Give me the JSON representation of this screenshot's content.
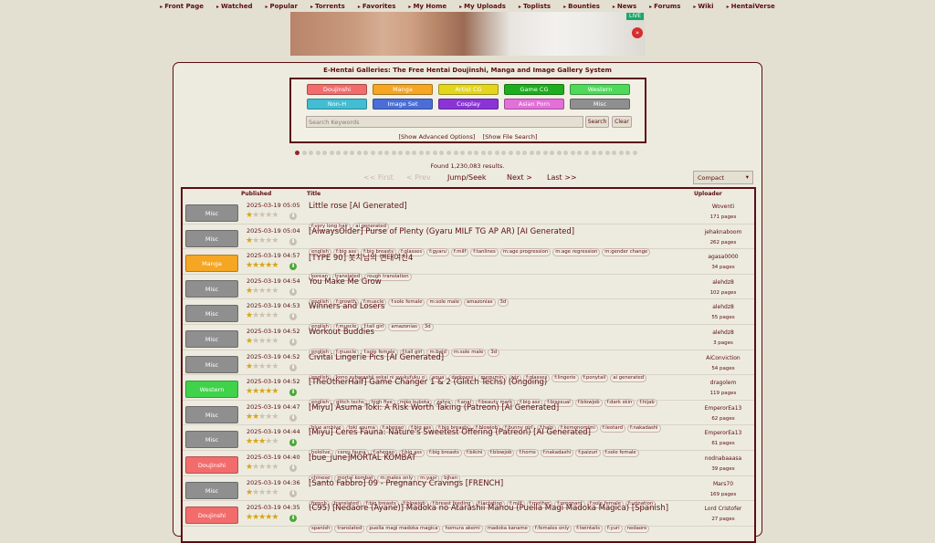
{
  "nav": [
    "Front Page",
    "Watched",
    "Popular",
    "Torrents",
    "Favorites",
    "My Home",
    "My Uploads",
    "Toplists",
    "Bounties",
    "News",
    "Forums",
    "Wiki",
    "HentaiVerse"
  ],
  "banner": {
    "live": "LIVE",
    "next": "»"
  },
  "title": "E-Hentai Galleries: The Free Hentai Doujinshi, Manga and Image Gallery System",
  "categories": [
    {
      "label": "Doujinshi",
      "color": "#f26c6c"
    },
    {
      "label": "Manga",
      "color": "#f5a623"
    },
    {
      "label": "Artist CG",
      "color": "#e3d61c"
    },
    {
      "label": "Game CG",
      "color": "#1ead1e"
    },
    {
      "label": "Western",
      "color": "#4fd95a"
    },
    {
      "label": "Non-H",
      "color": "#42bdd4"
    },
    {
      "label": "Image Set",
      "color": "#4b6ed6"
    },
    {
      "label": "Cosplay",
      "color": "#8b34d6"
    },
    {
      "label": "Asian Porn",
      "color": "#e36fd9"
    },
    {
      "label": "Misc",
      "color": "#8f8f8f"
    }
  ],
  "search": {
    "placeholder": "Search Keywords",
    "search_btn": "Search",
    "clear_btn": "Clear",
    "advanced": "[Show Advanced Options]",
    "file_search": "[Show File Search]"
  },
  "found": "Found 1,230,083 results.",
  "pager": {
    "first": "<< First",
    "prev": "< Prev",
    "jump": "Jump/Seek",
    "next": "Next >",
    "last": "Last >>"
  },
  "view_mode": "Compact",
  "headers": {
    "published": "Published",
    "title": "Title",
    "uploader": "Uploader"
  },
  "rows": [
    {
      "cat": "Misc",
      "color": "#8f8f8f",
      "date": "2025-03-19 05:05",
      "rating": 1,
      "title": "Little rose [AI Generated]",
      "tags": [
        "f:very long hair",
        "ai generated"
      ],
      "uploader": "Woventi",
      "pages": "171 pages"
    },
    {
      "cat": "Misc",
      "color": "#8f8f8f",
      "date": "2025-03-19 05:04",
      "rating": 1,
      "title": "[AlwaysOlder] Purse of Plenty (Gyaru MILF TG AP AR) [AI Generated]",
      "tags": [
        "english",
        "f:big ass",
        "f:big breasts",
        "f:glasses",
        "f:gyaru",
        "f:milf",
        "f:tanlines",
        "m:age progression",
        "m:age regression",
        "m:gender change"
      ],
      "uploader": "jehaknaboom",
      "pages": "262 pages"
    },
    {
      "cat": "Manga",
      "color": "#f5a623",
      "date": "2025-03-19 04:57",
      "rating": 5,
      "title": "[TYPE 90] 봇치님의 변태여친4",
      "tags": [
        "korean",
        "translated",
        "rough translation"
      ],
      "uploader": "agasa0000",
      "pages": "34 pages"
    },
    {
      "cat": "Misc",
      "color": "#8f8f8f",
      "date": "2025-03-19 04:54",
      "rating": 1,
      "title": "You Make Me Grow",
      "tags": [
        "english",
        "f:growth",
        "f:muscle",
        "f:sole female",
        "m:sole male",
        "amazonias",
        "3d"
      ],
      "uploader": "alehdz8",
      "pages": "102 pages"
    },
    {
      "cat": "Misc",
      "color": "#8f8f8f",
      "date": "2025-03-19 04:53",
      "rating": 1,
      "title": "Winners and Losers",
      "tags": [
        "english",
        "f:muscle",
        "f:tall girl",
        "amazonias",
        "3d"
      ],
      "uploader": "alehdz8",
      "pages": "55 pages"
    },
    {
      "cat": "Misc",
      "color": "#8f8f8f",
      "date": "2025-03-19 04:52",
      "rating": 1,
      "title": "Workout Buddies",
      "tags": [
        "english",
        "f:muscle",
        "f:sole female",
        "f:tall girl",
        "m:bald",
        "m:sole male",
        "3d"
      ],
      "uploader": "alehdz8",
      "pages": "3 pages"
    },
    {
      "cat": "Misc",
      "color": "#8f8f8f",
      "date": "2025-03-19 04:52",
      "rating": 1,
      "title": "Civitai Lingerie Pics [AI Generated]",
      "tags": [
        "english",
        "kono subarashii sekai ni syukufuku o",
        "aqua",
        "darkness",
        "megumin",
        "wiz",
        "f:glasses",
        "f:lingerie",
        "f:ponytail",
        "ai generated"
      ],
      "uploader": "AiConviction",
      "pages": "54 pages"
    },
    {
      "cat": "Western",
      "color": "#3fd24a",
      "date": "2025-03-19 04:52",
      "rating": 5,
      "title": "[TheOtherHalf] Game Changer 1 & 2 (Glitch Techs) (Ongoing)",
      "tags": [
        "english",
        "glitch techs",
        "high five",
        "miko kubota",
        "zahra",
        "f:anal",
        "f:beauty mark",
        "f:big ass",
        "f:bisexual",
        "f:blowjob",
        "f:dark skin",
        "f:hijab"
      ],
      "uploader": "dragolem",
      "pages": "119 pages"
    },
    {
      "cat": "Misc",
      "color": "#8f8f8f",
      "date": "2025-03-19 04:47",
      "rating": 2,
      "title": "[Miyu] Asuma Toki: A Risk Worth Taking (Patreon) [AI Generated]",
      "tags": [
        "blue archive",
        "toki asuma",
        "f:ahegao",
        "f:big ass",
        "f:big breasts",
        "f:blowjob",
        "f:bunny girl",
        "f:halo",
        "f:kemonomimi",
        "f:leotard",
        "f:nakadashi"
      ],
      "uploader": "EmperorEa13",
      "pages": "62 pages"
    },
    {
      "cat": "Misc",
      "color": "#8f8f8f",
      "date": "2025-03-19 04:44",
      "rating": 3,
      "title": "[Miyu] Ceres Fauna: Nature's Sweetest Offering (Patreon) [AI Generated]",
      "tags": [
        "hololive",
        "ceres fauna",
        "f:ahegao",
        "f:big ass",
        "f:big breasts",
        "f:bikini",
        "f:blowjob",
        "f:horns",
        "f:nakadashi",
        "f:paizuri",
        "f:sole female"
      ],
      "uploader": "EmperorEa13",
      "pages": "61 pages"
    },
    {
      "cat": "Doujinshi",
      "color": "#f26c6c",
      "date": "2025-03-19 04:40",
      "rating": 1,
      "title": "[bue_june]MORTAL KOMBAT",
      "tags": [
        "chinese",
        "mortal kombat",
        "m:males only",
        "m:yaoi",
        "bihan"
      ],
      "uploader": "nodnabaaasa",
      "pages": "39 pages"
    },
    {
      "cat": "Misc",
      "color": "#8f8f8f",
      "date": "2025-03-19 04:36",
      "rating": 1,
      "title": "[Santo Fabbro] 09 - Pregnancy Cravings [FRENCH]",
      "tags": [
        "french",
        "translated",
        "f:big breasts",
        "f:blowjob",
        "f:breast feeding",
        "f:lactation",
        "f:milf",
        "f:mother",
        "f:pregnant",
        "f:sole female",
        "f:urination"
      ],
      "uploader": "Mars70",
      "pages": "169 pages"
    },
    {
      "cat": "Doujinshi",
      "color": "#f26c6c",
      "date": "2025-03-19 04:35",
      "rating": 5,
      "title": "(C95) [Nedaore (Ayane)] Madoka no Atarashii Mahou (Puella Magi Madoka Magica) [Spanish]",
      "tags": [
        "spanish",
        "translated",
        "puella magi madoka magica",
        "homura akemi",
        "madoka kaname",
        "f:females only",
        "f:twintails",
        "f:yuri",
        "nedaore"
      ],
      "uploader": "Lord Cristofer",
      "pages": "27 pages"
    }
  ]
}
